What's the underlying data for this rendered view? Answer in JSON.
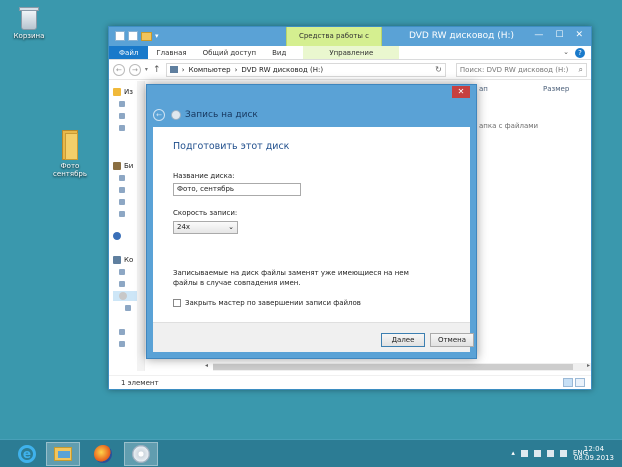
{
  "desktop": {
    "recycle_bin_label": "Корзина",
    "folder_label_line1": "Фото",
    "folder_label_line2": "сентябрь"
  },
  "explorer": {
    "window_title": "DVD RW дисковод (H:)",
    "contextual_group": "Средства работы с дисками",
    "tabs": [
      "Файл",
      "Главная",
      "Общий доступ",
      "Вид"
    ],
    "contextual_tab": "Управление",
    "address_parts": [
      "Компьютер",
      "DVD RW дисковод (H:)"
    ],
    "search_placeholder": "Поиск: DVD RW дисковод (H:)",
    "column_size": "Размер",
    "column_left_partial": "ап",
    "empty_hint_partial": "апка с файлами",
    "nav_items": [
      "Из",
      "Би",
      "Ко"
    ],
    "status_text": "1 элемент"
  },
  "dialog": {
    "title": "Запись на диск",
    "heading": "Подготовить этот диск",
    "disc_name_label": "Название диска:",
    "disc_name_value": "Фото, сентябрь",
    "speed_label": "Скорость записи:",
    "speed_value": "24x",
    "note": "Записываемые на диск файлы заменят уже имеющиеся на нем файлы в случае совпадения имен.",
    "checkbox_label": "Закрыть мастер по завершении записи файлов",
    "checkbox_checked": false,
    "next_button": "Далее",
    "cancel_button": "Отмена"
  },
  "taskbar": {
    "language": "ENG",
    "time": "12:04",
    "date": "08.09.2013"
  },
  "colors": {
    "desktop": "#3a98ad",
    "titlebar": "#5aa2d6",
    "file_tab": "#1979ca",
    "contextual_tab": "#d5ef90",
    "close_button": "#c74040"
  }
}
